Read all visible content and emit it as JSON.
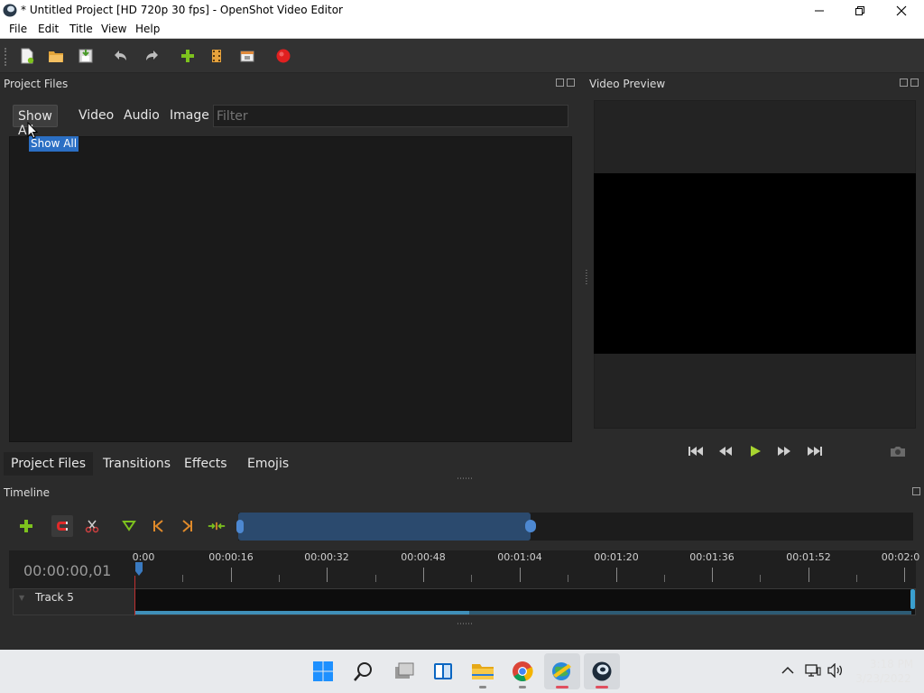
{
  "window": {
    "title": "* Untitled Project [HD 720p 30 fps] - OpenShot Video Editor"
  },
  "menu": [
    "File",
    "Edit",
    "Title",
    "View",
    "Help"
  ],
  "toolbar": {
    "icons": [
      "new-project-icon",
      "open-project-icon",
      "save-project-icon",
      "undo-icon",
      "redo-icon",
      "import-files-icon",
      "profile-icon",
      "fullscreen-icon",
      "export-video-icon"
    ]
  },
  "project_files": {
    "title": "Project Files",
    "filters": [
      "Show All",
      "Video",
      "Audio",
      "Image"
    ],
    "active_filter": "Show All",
    "filter_placeholder": "Filter",
    "tooltip": "Show All"
  },
  "bottom_tabs": {
    "items": [
      "Project Files",
      "Transitions",
      "Effects",
      "Emojis"
    ],
    "active": "Project Files"
  },
  "video_preview": {
    "title": "Video Preview"
  },
  "timeline": {
    "title": "Timeline",
    "current_time": "00:00:00,01",
    "ticks": [
      "0:00",
      "00:00:16",
      "00:00:32",
      "00:00:48",
      "00:01:04",
      "00:01:20",
      "00:01:36",
      "00:01:52",
      "00:02:0"
    ],
    "track_name": "Track 5"
  },
  "taskbar": {
    "time": "3:18 PM",
    "date": "3/23/2022"
  },
  "colors": {
    "accent": "#2b6fc4",
    "playhead": "#c03030",
    "record": "#e02020",
    "add_green": "#7dc21e"
  }
}
